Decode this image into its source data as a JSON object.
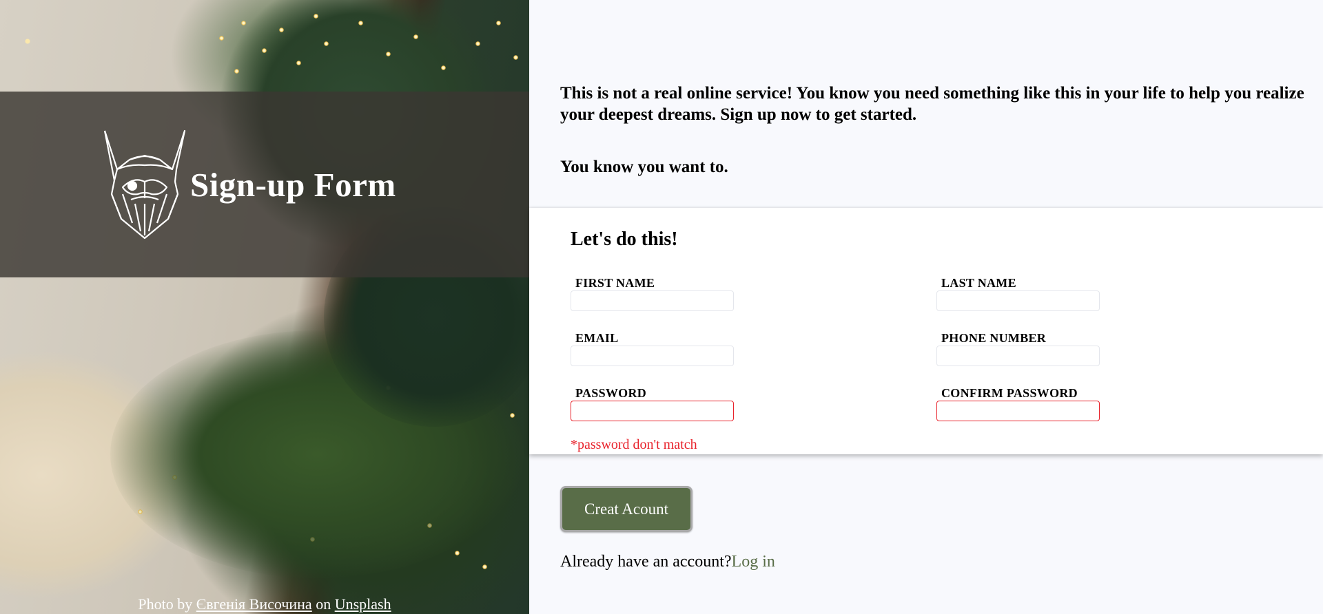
{
  "brand": {
    "title": "Sign-up Form",
    "logo_icon": "viking-head-icon"
  },
  "credit": {
    "prefix": "Photo by ",
    "author": "Євгенія Височина",
    "middle": " on ",
    "source": "Unsplash"
  },
  "intro": {
    "text": "This is not a real online service! You know you need something like this in your life to help you realize your deepest dreams. Sign up now to get started.",
    "text2": "You know you want to."
  },
  "form": {
    "heading": "Let's do this!",
    "fields": {
      "first_name": {
        "label": "FIRST NAME",
        "value": ""
      },
      "last_name": {
        "label": "LAST NAME",
        "value": ""
      },
      "email": {
        "label": "EMAIL",
        "value": ""
      },
      "phone": {
        "label": "PHONE NUMBER",
        "value": ""
      },
      "password": {
        "label": "PASSWORD",
        "value": ""
      },
      "confirm_password": {
        "label": "CONFIRM PASSWORD",
        "value": ""
      }
    },
    "error": "*password don't match"
  },
  "actions": {
    "submit_label": "Creat Acount",
    "login_prompt": "Already have an account?",
    "login_link": "Log in"
  },
  "colors": {
    "accent": "#596d48",
    "error": "#e8222b",
    "background": "#f8f9fd"
  }
}
